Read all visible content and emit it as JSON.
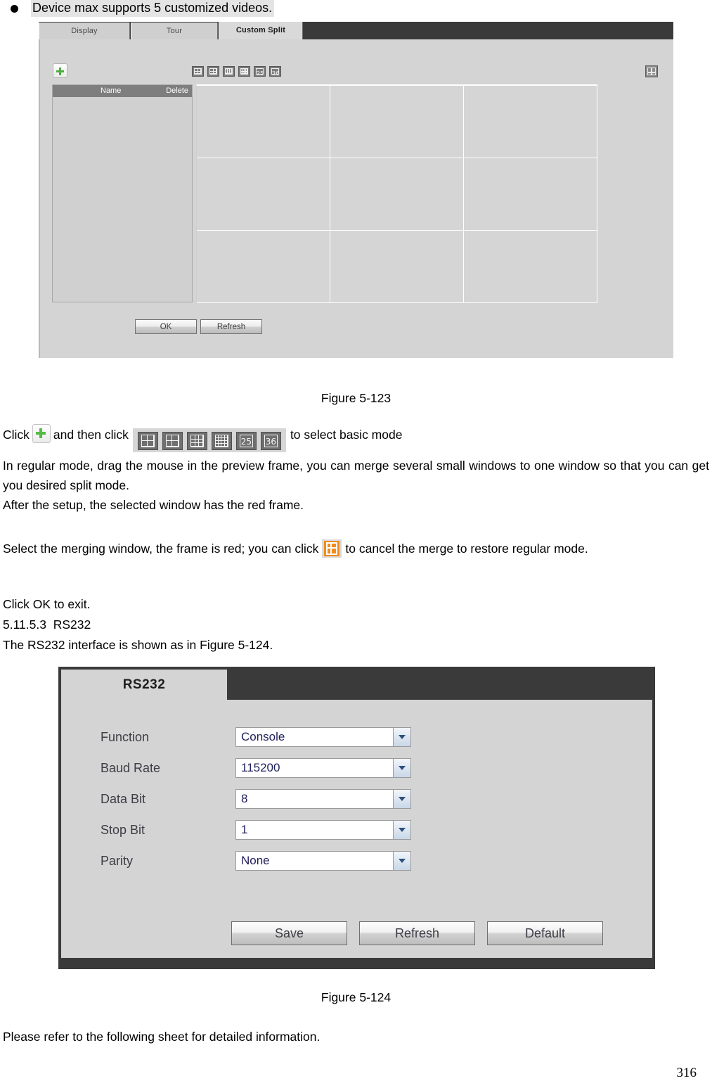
{
  "page": {
    "number": "316"
  },
  "note": {
    "bullet_text": "Device max supports 5 customized videos."
  },
  "figure_custom_split": {
    "caption": "Figure 5-123",
    "tabs": [
      {
        "label": "Display",
        "active": false
      },
      {
        "label": "Tour",
        "active": false
      },
      {
        "label": "Custom Split",
        "active": true
      }
    ],
    "add_button_icon": "plus-icon",
    "split_modes": [
      {
        "name": "split-4-icon",
        "label": "4",
        "rows": 2,
        "cols": 2
      },
      {
        "name": "split-6-icon",
        "label": "6",
        "rows": 2,
        "cols": 2
      },
      {
        "name": "split-9-icon",
        "label": "9",
        "rows": 3,
        "cols": 3
      },
      {
        "name": "split-16-icon",
        "label": "16",
        "rows": 4,
        "cols": 4
      },
      {
        "name": "split-25-icon",
        "label": "25",
        "rows": 0,
        "cols": 0
      },
      {
        "name": "split-36-icon",
        "label": "36",
        "rows": 0,
        "cols": 0
      }
    ],
    "merge_cancel_icon": "merge-cancel-icon",
    "list_headers": {
      "name": "Name",
      "delete": "Delete"
    },
    "list_rows": [],
    "preview_grid": {
      "rows": 3,
      "cols": 3,
      "cells": 9
    },
    "buttons": {
      "ok": "OK",
      "refresh": "Refresh"
    }
  },
  "prose": {
    "click_line_prefix": "Click",
    "click_line_middle": "and then click",
    "click_line_suffix": "to select basic mode",
    "paragraph_regular_mode": "In regular mode, drag the mouse in the preview frame, you can merge several small windows to one window so that you can get you desired split mode.",
    "paragraph_after_setup": "After the setup, the selected window has the red frame.",
    "merge_line_prefix": "Select the merging window, the frame is red; you can click",
    "merge_line_suffix": "to cancel the merge to restore regular mode.",
    "click_ok_to_exit": "Click OK to exit.",
    "section_number": "5.11.5.3",
    "section_title": "RS232",
    "rs232_intro": "The RS232 interface is shown as in Figure 5-124.",
    "refer_sheet": "Please refer to the following sheet for detailed information."
  },
  "figure_rs232": {
    "caption": "Figure 5-124",
    "tab_label": "RS232",
    "fields": [
      {
        "label": "Function",
        "value": "Console",
        "name": "function"
      },
      {
        "label": "Baud Rate",
        "value": "115200",
        "name": "baud-rate"
      },
      {
        "label": "Data Bit",
        "value": "8",
        "name": "data-bit"
      },
      {
        "label": "Stop Bit",
        "value": "1",
        "name": "stop-bit"
      },
      {
        "label": "Parity",
        "value": "None",
        "name": "parity"
      }
    ],
    "buttons": {
      "save": "Save",
      "refresh": "Refresh",
      "default": "Default"
    }
  },
  "colors": {
    "window_dark": "#3a3a3a",
    "window_body": "#d4d4d4",
    "accent_green": "#4caf3f",
    "accent_orange": "#f08c1e",
    "list_header": "#7e7e7e",
    "select_text": "#20205a"
  }
}
